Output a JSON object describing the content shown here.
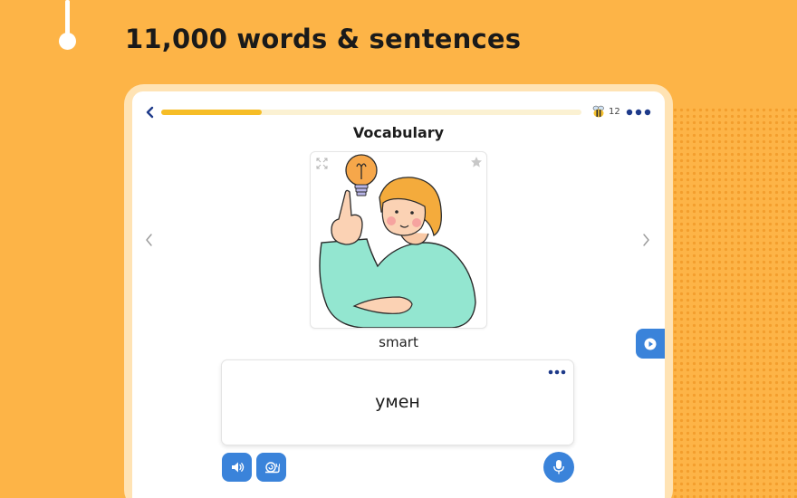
{
  "headline": "11,000 words & sentences",
  "header": {
    "progress_fraction": 0.24,
    "bee_count": "12",
    "back_icon": "chevron-left-icon",
    "more_icon": "more-horizontal-icon"
  },
  "lesson": {
    "title": "Vocabulary",
    "image_alt": "person pointing up with lightbulb idea",
    "word": "smart",
    "translation": "умен"
  },
  "controls": {
    "sound_icon": "speaker-icon",
    "slow_icon": "snail-icon",
    "mic_icon": "microphone-icon",
    "play_icon": "play-icon"
  },
  "colors": {
    "background": "#FDB447",
    "accent_blue": "#3a83da",
    "progress_fill": "#f6bd27",
    "progress_track": "#fbf1d2",
    "dark_navy": "#1e3a8a"
  }
}
